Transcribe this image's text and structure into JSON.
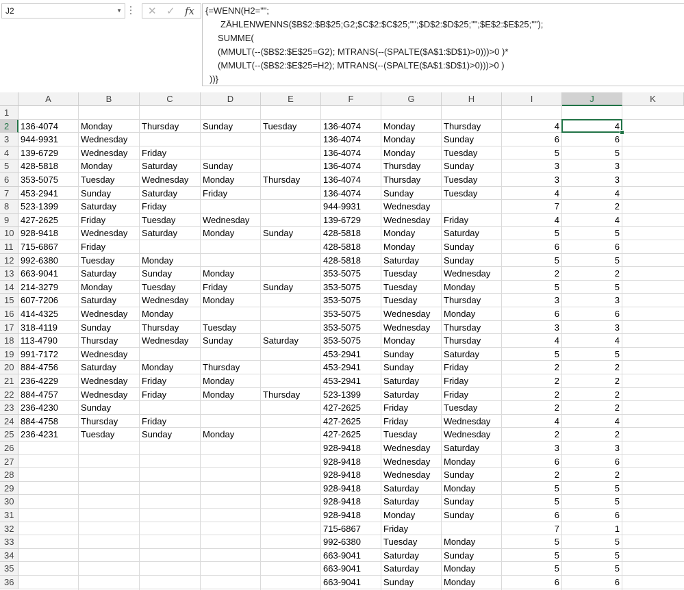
{
  "name_box": "J2",
  "formula_lines": [
    "{=WENN(H2=\"\";",
    "ZÄHLENWENNS($B$2:$B$25;G2;$C$2:$C$25;\"\";$D$2:$D$25;\"\";$E$2:$E$25;\"\");",
    "SUMME(",
    "(MMULT(--($B$2:$E$25=G2); MTRANS(--(SPALTE($A$1:$D$1)>0)))>0 )*",
    "(MMULT(--($B$2:$E$25=H2); MTRANS(--(SPALTE($A$1:$D$1)>0)))>0 )",
    "))}"
  ],
  "icons": {
    "cancel": "cancel-x-icon",
    "enter": "check-icon",
    "function": "fx-icon"
  },
  "columns": [
    "A",
    "B",
    "C",
    "D",
    "E",
    "F",
    "G",
    "H",
    "I",
    "J",
    "K"
  ],
  "rows": [
    {
      "n": "1",
      "A": "",
      "B": "",
      "C": "",
      "D": "",
      "E": "",
      "F": "",
      "G": "",
      "H": "",
      "I": "",
      "J": ""
    },
    {
      "n": "2",
      "A": "136-4074",
      "B": "Monday",
      "C": "Thursday",
      "D": "Sunday",
      "E": "Tuesday",
      "F": "136-4074",
      "G": "Monday",
      "H": "Thursday",
      "I": "4",
      "J": "4"
    },
    {
      "n": "3",
      "A": "944-9931",
      "B": "Wednesday",
      "C": "",
      "D": "",
      "E": "",
      "F": "136-4074",
      "G": "Monday",
      "H": "Sunday",
      "I": "6",
      "J": "6"
    },
    {
      "n": "4",
      "A": "139-6729",
      "B": "Wednesday",
      "C": "Friday",
      "D": "",
      "E": "",
      "F": "136-4074",
      "G": "Monday",
      "H": "Tuesday",
      "I": "5",
      "J": "5"
    },
    {
      "n": "5",
      "A": "428-5818",
      "B": "Monday",
      "C": "Saturday",
      "D": "Sunday",
      "E": "",
      "F": "136-4074",
      "G": "Thursday",
      "H": "Sunday",
      "I": "3",
      "J": "3"
    },
    {
      "n": "6",
      "A": "353-5075",
      "B": "Tuesday",
      "C": "Wednesday",
      "D": "Monday",
      "E": "Thursday",
      "F": "136-4074",
      "G": "Thursday",
      "H": "Tuesday",
      "I": "3",
      "J": "3"
    },
    {
      "n": "7",
      "A": "453-2941",
      "B": "Sunday",
      "C": "Saturday",
      "D": "Friday",
      "E": "",
      "F": "136-4074",
      "G": "Sunday",
      "H": "Tuesday",
      "I": "4",
      "J": "4"
    },
    {
      "n": "8",
      "A": "523-1399",
      "B": "Saturday",
      "C": "Friday",
      "D": "",
      "E": "",
      "F": "944-9931",
      "G": "Wednesday",
      "H": "",
      "I": "7",
      "J": "2"
    },
    {
      "n": "9",
      "A": "427-2625",
      "B": "Friday",
      "C": "Tuesday",
      "D": "Wednesday",
      "E": "",
      "F": "139-6729",
      "G": "Wednesday",
      "H": "Friday",
      "I": "4",
      "J": "4"
    },
    {
      "n": "10",
      "A": "928-9418",
      "B": "Wednesday",
      "C": "Saturday",
      "D": "Monday",
      "E": "Sunday",
      "F": "428-5818",
      "G": "Monday",
      "H": "Saturday",
      "I": "5",
      "J": "5"
    },
    {
      "n": "11",
      "A": "715-6867",
      "B": "Friday",
      "C": "",
      "D": "",
      "E": "",
      "F": "428-5818",
      "G": "Monday",
      "H": "Sunday",
      "I": "6",
      "J": "6"
    },
    {
      "n": "12",
      "A": "992-6380",
      "B": "Tuesday",
      "C": "Monday",
      "D": "",
      "E": "",
      "F": "428-5818",
      "G": "Saturday",
      "H": "Sunday",
      "I": "5",
      "J": "5"
    },
    {
      "n": "13",
      "A": "663-9041",
      "B": "Saturday",
      "C": "Sunday",
      "D": "Monday",
      "E": "",
      "F": "353-5075",
      "G": "Tuesday",
      "H": "Wednesday",
      "I": "2",
      "J": "2"
    },
    {
      "n": "14",
      "A": "214-3279",
      "B": "Monday",
      "C": "Tuesday",
      "D": "Friday",
      "E": "Sunday",
      "F": "353-5075",
      "G": "Tuesday",
      "H": "Monday",
      "I": "5",
      "J": "5"
    },
    {
      "n": "15",
      "A": "607-7206",
      "B": "Saturday",
      "C": "Wednesday",
      "D": "Monday",
      "E": "",
      "F": "353-5075",
      "G": "Tuesday",
      "H": "Thursday",
      "I": "3",
      "J": "3"
    },
    {
      "n": "16",
      "A": "414-4325",
      "B": "Wednesday",
      "C": "Monday",
      "D": "",
      "E": "",
      "F": "353-5075",
      "G": "Wednesday",
      "H": "Monday",
      "I": "6",
      "J": "6"
    },
    {
      "n": "17",
      "A": "318-4119",
      "B": "Sunday",
      "C": "Thursday",
      "D": "Tuesday",
      "E": "",
      "F": "353-5075",
      "G": "Wednesday",
      "H": "Thursday",
      "I": "3",
      "J": "3"
    },
    {
      "n": "18",
      "A": "113-4790",
      "B": "Thursday",
      "C": "Wednesday",
      "D": "Sunday",
      "E": "Saturday",
      "F": "353-5075",
      "G": "Monday",
      "H": "Thursday",
      "I": "4",
      "J": "4"
    },
    {
      "n": "19",
      "A": "991-7172",
      "B": "Wednesday",
      "C": "",
      "D": "",
      "E": "",
      "F": "453-2941",
      "G": "Sunday",
      "H": "Saturday",
      "I": "5",
      "J": "5"
    },
    {
      "n": "20",
      "A": "884-4756",
      "B": "Saturday",
      "C": "Monday",
      "D": "Thursday",
      "E": "",
      "F": "453-2941",
      "G": "Sunday",
      "H": "Friday",
      "I": "2",
      "J": "2"
    },
    {
      "n": "21",
      "A": "236-4229",
      "B": "Wednesday",
      "C": "Friday",
      "D": "Monday",
      "E": "",
      "F": "453-2941",
      "G": "Saturday",
      "H": "Friday",
      "I": "2",
      "J": "2"
    },
    {
      "n": "22",
      "A": "884-4757",
      "B": "Wednesday",
      "C": "Friday",
      "D": "Monday",
      "E": "Thursday",
      "F": "523-1399",
      "G": "Saturday",
      "H": "Friday",
      "I": "2",
      "J": "2"
    },
    {
      "n": "23",
      "A": "236-4230",
      "B": "Sunday",
      "C": "",
      "D": "",
      "E": "",
      "F": "427-2625",
      "G": "Friday",
      "H": "Tuesday",
      "I": "2",
      "J": "2"
    },
    {
      "n": "24",
      "A": "884-4758",
      "B": "Thursday",
      "C": "Friday",
      "D": "",
      "E": "",
      "F": "427-2625",
      "G": "Friday",
      "H": "Wednesday",
      "I": "4",
      "J": "4"
    },
    {
      "n": "25",
      "A": "236-4231",
      "B": "Tuesday",
      "C": "Sunday",
      "D": "Monday",
      "E": "",
      "F": "427-2625",
      "G": "Tuesday",
      "H": "Wednesday",
      "I": "2",
      "J": "2"
    },
    {
      "n": "26",
      "A": "",
      "B": "",
      "C": "",
      "D": "",
      "E": "",
      "F": "928-9418",
      "G": "Wednesday",
      "H": "Saturday",
      "I": "3",
      "J": "3"
    },
    {
      "n": "27",
      "A": "",
      "B": "",
      "C": "",
      "D": "",
      "E": "",
      "F": "928-9418",
      "G": "Wednesday",
      "H": "Monday",
      "I": "6",
      "J": "6"
    },
    {
      "n": "28",
      "A": "",
      "B": "",
      "C": "",
      "D": "",
      "E": "",
      "F": "928-9418",
      "G": "Wednesday",
      "H": "Sunday",
      "I": "2",
      "J": "2"
    },
    {
      "n": "29",
      "A": "",
      "B": "",
      "C": "",
      "D": "",
      "E": "",
      "F": "928-9418",
      "G": "Saturday",
      "H": "Monday",
      "I": "5",
      "J": "5"
    },
    {
      "n": "30",
      "A": "",
      "B": "",
      "C": "",
      "D": "",
      "E": "",
      "F": "928-9418",
      "G": "Saturday",
      "H": "Sunday",
      "I": "5",
      "J": "5"
    },
    {
      "n": "31",
      "A": "",
      "B": "",
      "C": "",
      "D": "",
      "E": "",
      "F": "928-9418",
      "G": "Monday",
      "H": "Sunday",
      "I": "6",
      "J": "6"
    },
    {
      "n": "32",
      "A": "",
      "B": "",
      "C": "",
      "D": "",
      "E": "",
      "F": "715-6867",
      "G": "Friday",
      "H": "",
      "I": "7",
      "J": "1"
    },
    {
      "n": "33",
      "A": "",
      "B": "",
      "C": "",
      "D": "",
      "E": "",
      "F": "992-6380",
      "G": "Tuesday",
      "H": "Monday",
      "I": "5",
      "J": "5"
    },
    {
      "n": "34",
      "A": "",
      "B": "",
      "C": "",
      "D": "",
      "E": "",
      "F": "663-9041",
      "G": "Saturday",
      "H": "Sunday",
      "I": "5",
      "J": "5"
    },
    {
      "n": "35",
      "A": "",
      "B": "",
      "C": "",
      "D": "",
      "E": "",
      "F": "663-9041",
      "G": "Saturday",
      "H": "Monday",
      "I": "5",
      "J": "5"
    },
    {
      "n": "36",
      "A": "",
      "B": "",
      "C": "",
      "D": "",
      "E": "",
      "F": "663-9041",
      "G": "Sunday",
      "H": "Monday",
      "I": "6",
      "J": "6"
    }
  ],
  "colors": {
    "accent": "#217346",
    "header_bg": "#f2f2f2",
    "selected_header_bg": "#d2d2d2",
    "grid": "#dadada"
  },
  "selection": {
    "column": "J",
    "row": "2"
  }
}
